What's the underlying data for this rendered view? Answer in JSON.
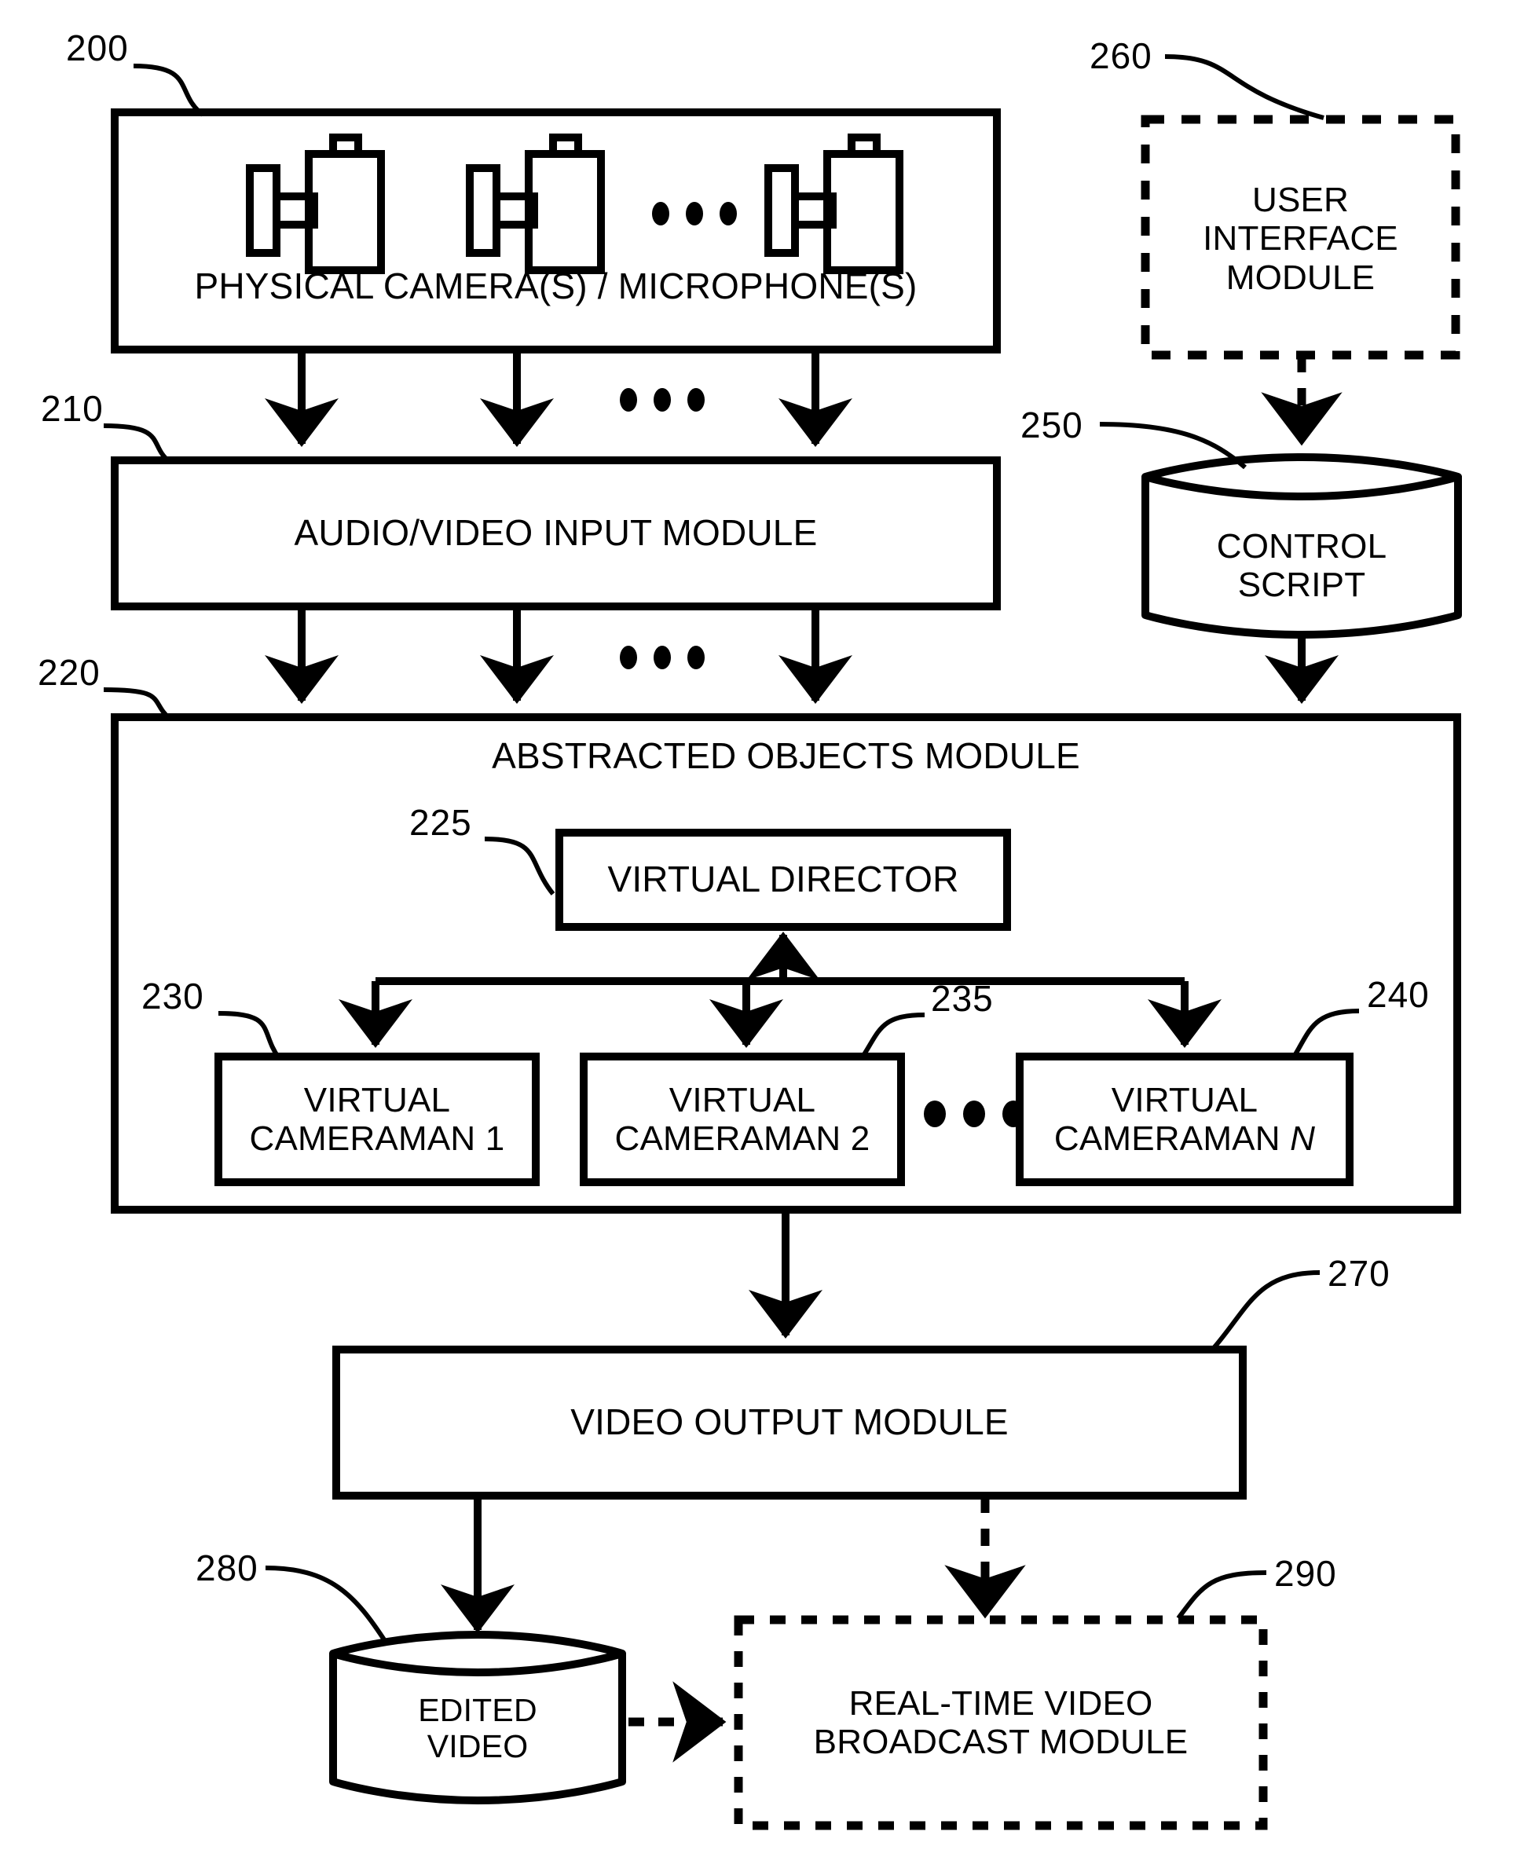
{
  "figure": {
    "type": "patent-block-diagram",
    "background": "#ffffff",
    "stroke_color": "#000000"
  },
  "blocks": {
    "physical_cameras": {
      "ref": "200",
      "label": "PHYSICAL CAMERA(S) / MICROPHONE(S)",
      "style": "solid-rect",
      "icons": [
        "camera-icon",
        "camera-icon",
        "ellipsis",
        "camera-icon"
      ]
    },
    "av_input": {
      "ref": "210",
      "label": "AUDIO/VIDEO INPUT MODULE",
      "style": "solid-rect"
    },
    "abstracted_objects": {
      "ref": "220",
      "label": "ABSTRACTED OBJECTS MODULE",
      "style": "solid-rect"
    },
    "virtual_director": {
      "ref": "225",
      "label": "VIRTUAL DIRECTOR",
      "style": "solid-rect"
    },
    "virtual_cameraman_1": {
      "ref": "230",
      "label_line1": "VIRTUAL",
      "label_line2": "CAMERAMAN 1",
      "style": "solid-rect"
    },
    "virtual_cameraman_2": {
      "ref": "235",
      "label_line1": "VIRTUAL",
      "label_line2": "CAMERAMAN 2",
      "style": "solid-rect"
    },
    "virtual_cameraman_n": {
      "ref": "240",
      "label_line1": "VIRTUAL",
      "label_line2_prefix": "CAMERAMAN ",
      "label_line2_italic": "N",
      "style": "solid-rect"
    },
    "control_script": {
      "ref": "250",
      "label_line1": "CONTROL",
      "label_line2": "SCRIPT",
      "style": "cylinder"
    },
    "user_interface": {
      "ref": "260",
      "label_line1": "USER",
      "label_line2": "INTERFACE",
      "label_line3": "MODULE",
      "style": "dashed-rect"
    },
    "video_output": {
      "ref": "270",
      "label": "VIDEO OUTPUT MODULE",
      "style": "solid-rect"
    },
    "edited_video": {
      "ref": "280",
      "label_line1": "EDITED",
      "label_line2": "VIDEO",
      "style": "cylinder"
    },
    "realtime_broadcast": {
      "ref": "290",
      "label_line1": "REAL-TIME VIDEO",
      "label_line2": "BROADCAST MODULE",
      "style": "dashed-rect"
    }
  },
  "ellipses": {
    "cameras_row": "•••",
    "below_cameras": "•••",
    "below_av_input": "•••",
    "cameramen_row": "•••"
  },
  "connections": [
    {
      "from": "physical_cameras",
      "to": "av_input",
      "style": "solid-arrow",
      "count": 3
    },
    {
      "from": "av_input",
      "to": "abstracted_objects",
      "style": "solid-arrow",
      "count": 3
    },
    {
      "from": "user_interface",
      "to": "control_script",
      "style": "dashed-arrow"
    },
    {
      "from": "control_script",
      "to": "abstracted_objects",
      "style": "solid-arrow"
    },
    {
      "from": "virtual_cameramen",
      "to": "virtual_director",
      "style": "solid-arrow-bus"
    },
    {
      "from": "abstracted_objects",
      "to": "video_output",
      "style": "solid-arrow"
    },
    {
      "from": "video_output",
      "to": "edited_video",
      "style": "solid-arrow"
    },
    {
      "from": "video_output",
      "to": "realtime_broadcast",
      "style": "dashed-arrow"
    },
    {
      "from": "edited_video",
      "to": "realtime_broadcast",
      "style": "dashed-arrow"
    }
  ]
}
